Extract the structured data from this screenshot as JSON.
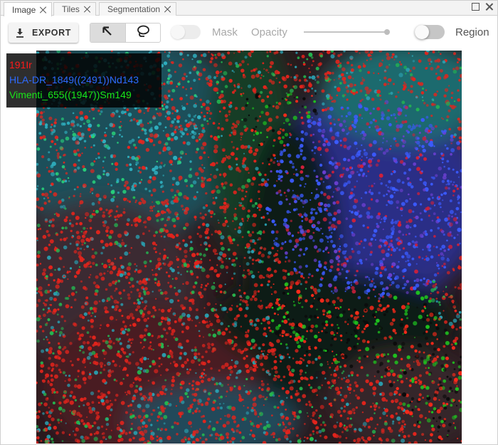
{
  "tabs": [
    {
      "label": "Image",
      "active": true
    },
    {
      "label": "Tiles",
      "active": false
    },
    {
      "label": "Segmentation",
      "active": false
    }
  ],
  "toolbar": {
    "export_label": "EXPORT",
    "mask_label": "Mask",
    "opacity_label": "Opacity",
    "opacity_value": 1.0,
    "region_label": "Region",
    "mask_enabled": false,
    "region_enabled": false,
    "selected_tool": "pointer"
  },
  "channels": [
    {
      "label": "191Ir",
      "color": "#ff1a1a"
    },
    {
      "label": "HLA-DR_1849((2491))Nd143",
      "color": "#2e6bff"
    },
    {
      "label": "Vimenti_655((1947))Sm149",
      "color": "#19e619"
    }
  ],
  "icons": {
    "export": "download-icon",
    "pointer_tool": "arrow-pointer-icon",
    "lasso_tool": "lasso-icon",
    "tab_close": "close-icon",
    "window_maximize": "maximize-icon",
    "window_close": "close-icon"
  }
}
